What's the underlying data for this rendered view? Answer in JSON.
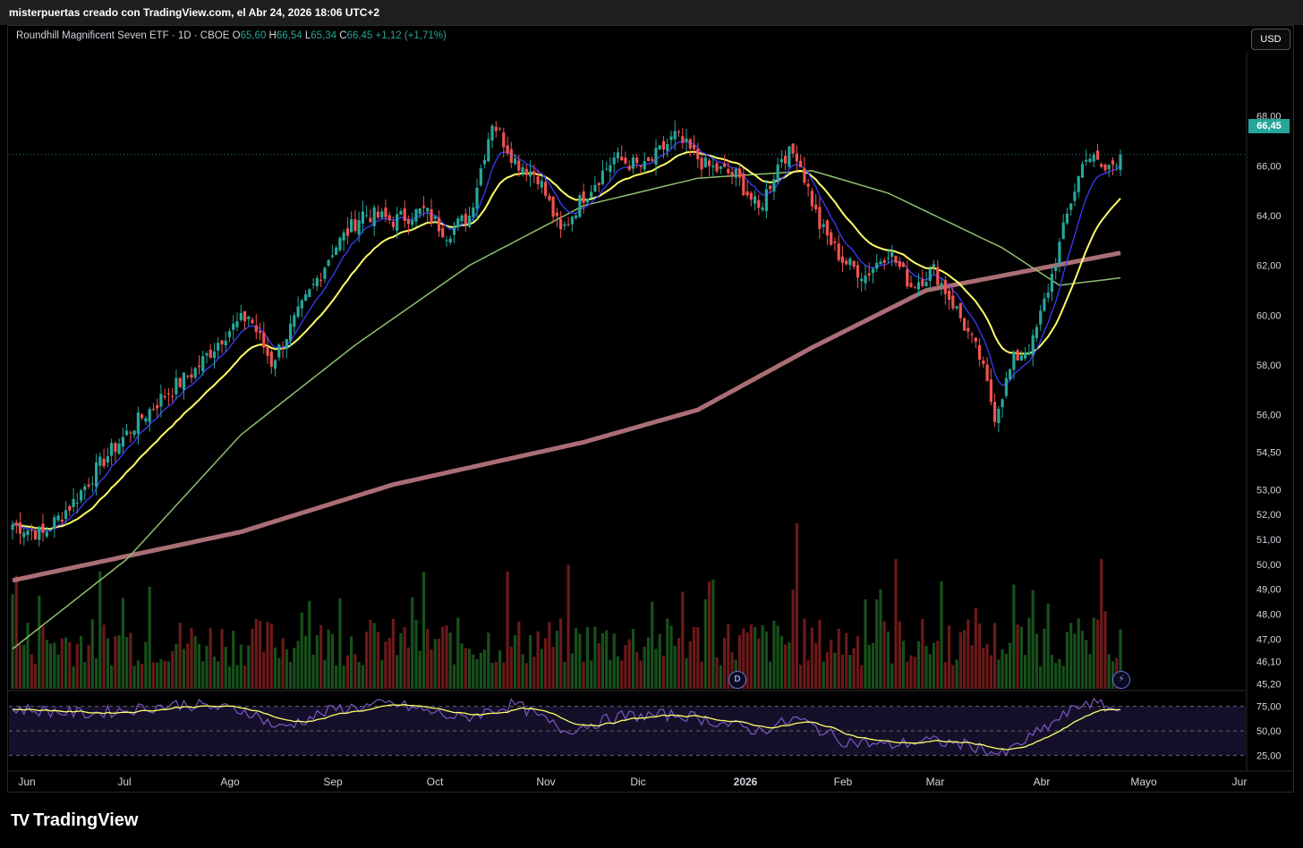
{
  "header": {
    "caption": "misterpuertas creado con TradingView.com, el Abr 24, 2026 18:06 UTC+2"
  },
  "legend": {
    "symbol": "Roundhill Magnificent Seven ETF · 1D · CBOE",
    "o_label": "O",
    "o": "65,60",
    "h_label": "H",
    "h": "66,54",
    "l_label": "L",
    "l": "65,34",
    "c_label": "C",
    "c": "66,45",
    "change": "+1,12 (+1,71%)"
  },
  "currency": "USD",
  "last_price": "66,45",
  "brand": {
    "logo": "TV",
    "name": "TradingView"
  },
  "badges": {
    "dividend": "D",
    "flash": "⚡"
  },
  "colors": {
    "up": "#26a69a",
    "down": "#ef5350",
    "ema_fast": "#3b3bff",
    "ema_mid": "#ffff66",
    "sma_slow": "#8fbf6e",
    "sma_long": "#c9818a",
    "rsi": "#7e57c2",
    "rsi_ma": "#ffff66"
  },
  "chart_data": {
    "type": "line",
    "title": "",
    "price_ticks": [
      "68,00",
      "66,00",
      "64,00",
      "62,00",
      "60,00",
      "58,00",
      "56,00",
      "54,50",
      "53,00",
      "52,00",
      "51,00",
      "50,00",
      "49,00",
      "48,00",
      "47,00",
      "46,10",
      "45,20"
    ],
    "rsi_ticks": [
      "75,00",
      "50,00",
      "25,00"
    ],
    "x_ticks": [
      "Jun",
      "Jul",
      "Ago",
      "Sep",
      "Oct",
      "Nov",
      "Dic",
      "2026",
      "Feb",
      "Mar",
      "Abr",
      "Mayo",
      "Jur"
    ],
    "close_keypoints": [
      {
        "t": 0,
        "v": 51.6
      },
      {
        "t": 8,
        "v": 51.2
      },
      {
        "t": 16,
        "v": 52.5
      },
      {
        "t": 24,
        "v": 54.2
      },
      {
        "t": 32,
        "v": 55.6
      },
      {
        "t": 40,
        "v": 56.8
      },
      {
        "t": 48,
        "v": 57.8
      },
      {
        "t": 56,
        "v": 59.3
      },
      {
        "t": 62,
        "v": 60.0
      },
      {
        "t": 68,
        "v": 58.1
      },
      {
        "t": 76,
        "v": 60.3
      },
      {
        "t": 84,
        "v": 62.6
      },
      {
        "t": 92,
        "v": 64.1
      },
      {
        "t": 100,
        "v": 63.8
      },
      {
        "t": 108,
        "v": 64.2
      },
      {
        "t": 114,
        "v": 63.3
      },
      {
        "t": 120,
        "v": 64.0
      },
      {
        "t": 126,
        "v": 67.8
      },
      {
        "t": 132,
        "v": 66.2
      },
      {
        "t": 138,
        "v": 65.6
      },
      {
        "t": 144,
        "v": 63.3
      },
      {
        "t": 150,
        "v": 64.8
      },
      {
        "t": 158,
        "v": 66.3
      },
      {
        "t": 166,
        "v": 65.9
      },
      {
        "t": 174,
        "v": 67.2
      },
      {
        "t": 182,
        "v": 66.0
      },
      {
        "t": 190,
        "v": 65.6
      },
      {
        "t": 196,
        "v": 64.2
      },
      {
        "t": 202,
        "v": 66.4
      },
      {
        "t": 206,
        "v": 66.5
      },
      {
        "t": 212,
        "v": 63.6
      },
      {
        "t": 218,
        "v": 62.2
      },
      {
        "t": 224,
        "v": 61.6
      },
      {
        "t": 230,
        "v": 62.6
      },
      {
        "t": 236,
        "v": 61.2
      },
      {
        "t": 242,
        "v": 61.8
      },
      {
        "t": 248,
        "v": 60.2
      },
      {
        "t": 254,
        "v": 58.3
      },
      {
        "t": 258,
        "v": 56.0
      },
      {
        "t": 263,
        "v": 58.2
      },
      {
        "t": 268,
        "v": 58.9
      },
      {
        "t": 273,
        "v": 61.6
      },
      {
        "t": 278,
        "v": 64.6
      },
      {
        "t": 282,
        "v": 66.5
      },
      {
        "t": 287,
        "v": 65.8
      },
      {
        "t": 291,
        "v": 66.45
      }
    ],
    "sma200_keypoints": [
      {
        "t": 0,
        "v": 49.35
      },
      {
        "t": 60,
        "v": 51.3
      },
      {
        "t": 100,
        "v": 53.2
      },
      {
        "t": 150,
        "v": 54.9
      },
      {
        "t": 180,
        "v": 56.2
      },
      {
        "t": 210,
        "v": 58.7
      },
      {
        "t": 240,
        "v": 61.0
      },
      {
        "t": 291,
        "v": 62.5
      }
    ],
    "sma50_keypoints": [
      {
        "t": 0,
        "v": 46.6
      },
      {
        "t": 30,
        "v": 50.2
      },
      {
        "t": 60,
        "v": 55.2
      },
      {
        "t": 90,
        "v": 58.8
      },
      {
        "t": 120,
        "v": 62.0
      },
      {
        "t": 150,
        "v": 64.4
      },
      {
        "t": 180,
        "v": 65.5
      },
      {
        "t": 210,
        "v": 65.8
      },
      {
        "t": 230,
        "v": 64.9
      },
      {
        "t": 260,
        "v": 62.7
      },
      {
        "t": 275,
        "v": 61.2
      },
      {
        "t": 291,
        "v": 61.5
      }
    ],
    "rsi_keypoints": [
      {
        "t": 0,
        "v": 68
      },
      {
        "t": 20,
        "v": 64
      },
      {
        "t": 45,
        "v": 72
      },
      {
        "t": 62,
        "v": 66
      },
      {
        "t": 70,
        "v": 52
      },
      {
        "t": 85,
        "v": 68
      },
      {
        "t": 100,
        "v": 72
      },
      {
        "t": 118,
        "v": 60
      },
      {
        "t": 132,
        "v": 72
      },
      {
        "t": 145,
        "v": 50
      },
      {
        "t": 160,
        "v": 62
      },
      {
        "t": 176,
        "v": 63
      },
      {
        "t": 196,
        "v": 50
      },
      {
        "t": 206,
        "v": 60
      },
      {
        "t": 218,
        "v": 42
      },
      {
        "t": 230,
        "v": 38
      },
      {
        "t": 240,
        "v": 42
      },
      {
        "t": 252,
        "v": 38
      },
      {
        "t": 260,
        "v": 30
      },
      {
        "t": 270,
        "v": 50
      },
      {
        "t": 282,
        "v": 74
      },
      {
        "t": 291,
        "v": 66
      }
    ],
    "price_range": [
      45.0,
      70.5
    ],
    "rsi_range": [
      20,
      80
    ],
    "grid": false,
    "legend_placement": "top-left"
  }
}
